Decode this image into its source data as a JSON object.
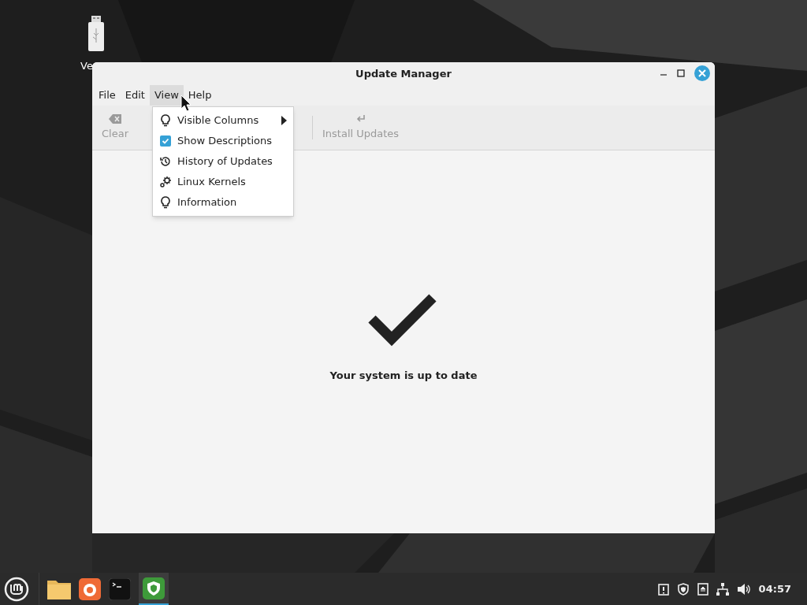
{
  "desktop": {
    "icons": [
      {
        "label": "Ve"
      }
    ]
  },
  "window": {
    "title": "Update Manager"
  },
  "menubar": [
    {
      "label": "File",
      "selected": false
    },
    {
      "label": "Edit",
      "selected": false
    },
    {
      "label": "View",
      "selected": true
    },
    {
      "label": "Help",
      "selected": false
    }
  ],
  "toolbar": [
    {
      "label": "Clear",
      "disabled": true
    },
    {
      "label": "Install Updates",
      "disabled": true
    }
  ],
  "view_menu": [
    {
      "label": "Visible Columns",
      "kind": "submenu"
    },
    {
      "label": "Show Descriptions",
      "kind": "check",
      "checked": true
    },
    {
      "label": "History of Updates",
      "kind": "item"
    },
    {
      "label": "Linux Kernels",
      "kind": "item"
    },
    {
      "label": "Information",
      "kind": "item"
    }
  ],
  "status": {
    "message": "Your system is up to date"
  },
  "taskbar": {
    "clock": "04:57"
  }
}
